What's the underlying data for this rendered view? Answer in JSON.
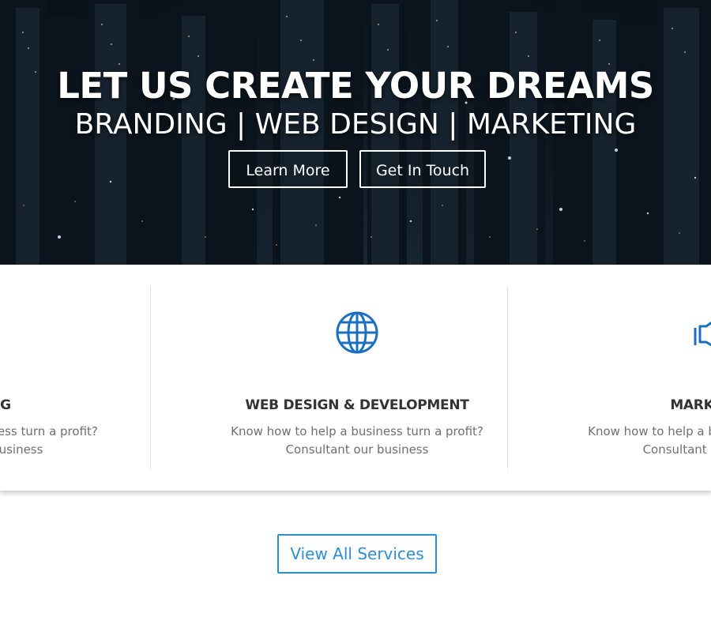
{
  "hero": {
    "title": "LET US CREATE YOUR DREAMS",
    "subtitle": "BRANDING | WEB DESIGN | MARKETING",
    "buttons": {
      "learn_more": "Learn More",
      "get_in_touch": "Get In Touch"
    }
  },
  "services": [
    {
      "title": "BRANDING",
      "desc_line1": "Know how to help a business turn a profit?",
      "desc_line2": "Consultant our business",
      "icon": "pencil-icon"
    },
    {
      "title": "WEB DESIGN & DEVELOPMENT",
      "desc_line1": "Know how to help a business turn a profit?",
      "desc_line2": "Consultant our business",
      "icon": "globe-icon"
    },
    {
      "title": "MARKETING",
      "desc_line1": "Know how to help a business turn a profit?",
      "desc_line2": "Consultant our business",
      "icon": "megaphone-icon"
    }
  ],
  "view_all_label": "View All Services",
  "colors": {
    "accent": "#1a6fc0",
    "button_blue": "#2b8fd6",
    "heading": "#333333",
    "body_text": "#6f6f6f"
  }
}
